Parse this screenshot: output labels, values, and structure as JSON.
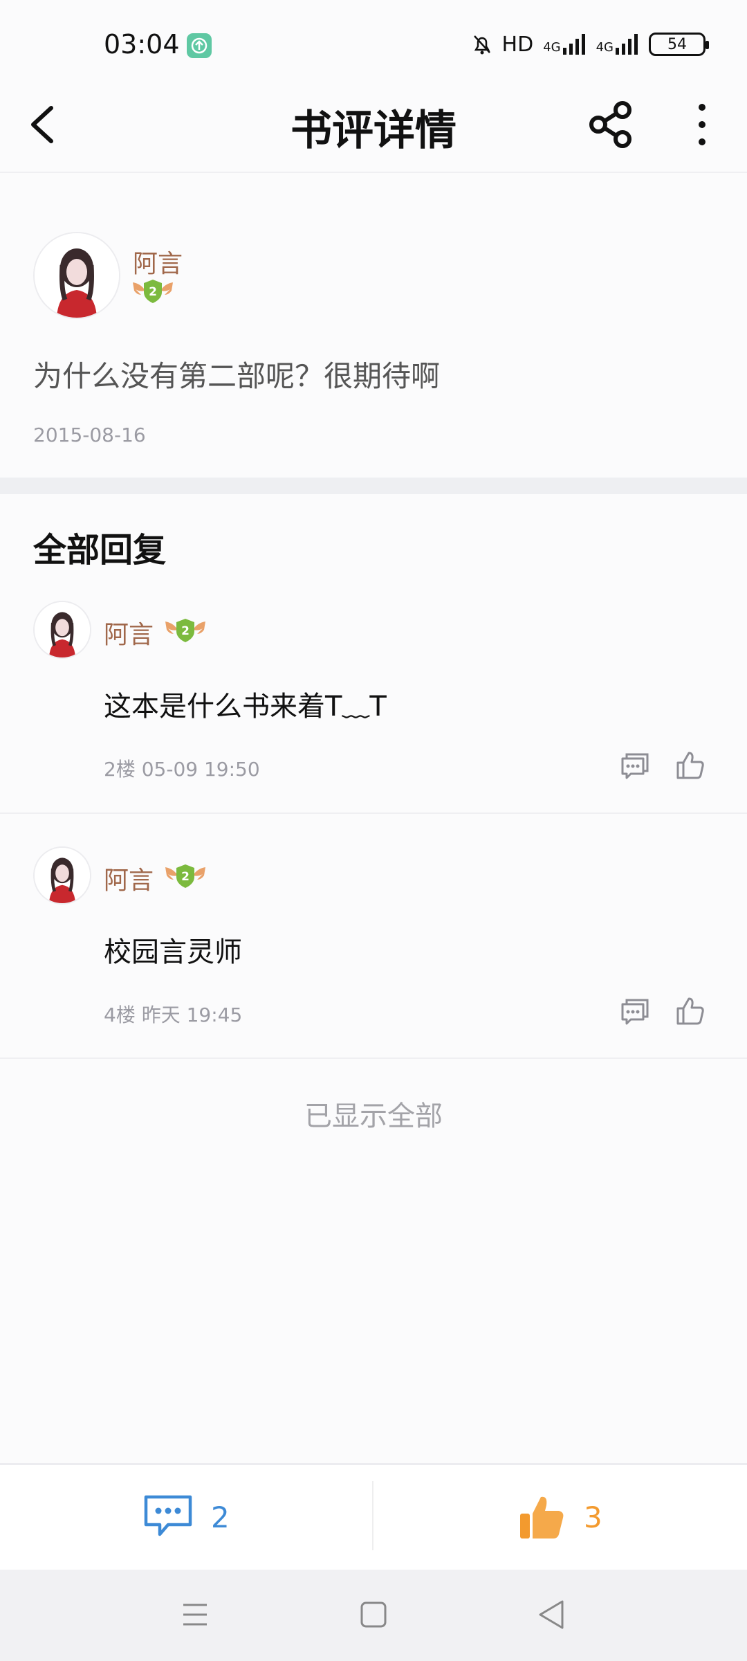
{
  "status_bar": {
    "time": "03:04",
    "network": "HD",
    "signal1": "4G",
    "signal2": "4G",
    "battery": "54"
  },
  "header": {
    "title": "书评详情"
  },
  "review": {
    "author": "阿言",
    "level": "2",
    "content": "为什么没有第二部呢？很期待啊",
    "date": "2015-08-16"
  },
  "replies_section": {
    "title": "全部回复"
  },
  "replies": [
    {
      "author": "阿言",
      "level": "2",
      "content": "这本是什么书来着T﹏T",
      "meta": "2楼 05-09 19:50"
    },
    {
      "author": "阿言",
      "level": "2",
      "content": "校园言灵师",
      "meta": "4楼 昨天 19:45"
    }
  ],
  "end_text": "已显示全部",
  "actions": {
    "comment_count": "2",
    "like_count": "3"
  },
  "colors": {
    "accent_blue": "#3d8ad6",
    "accent_orange": "#f39a2e",
    "username": "#a0674a"
  }
}
